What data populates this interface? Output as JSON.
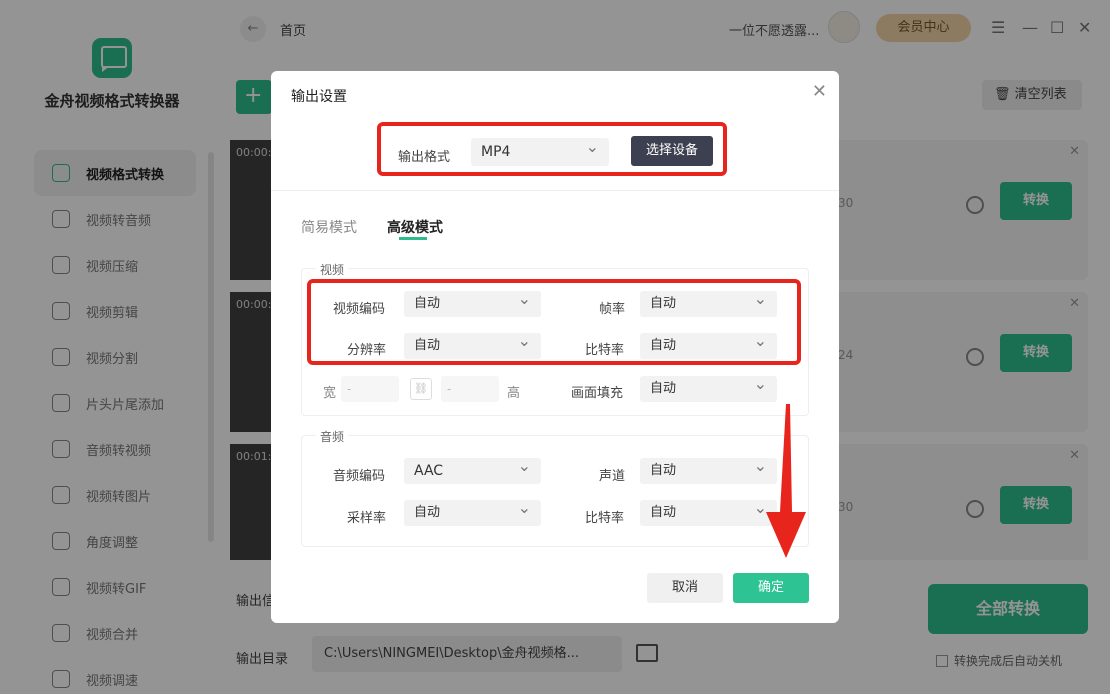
{
  "app": {
    "name": "金舟视频格式转换器"
  },
  "sidebar": {
    "items": [
      {
        "label": "视频格式转换",
        "icon": "convert-icon",
        "active": true
      },
      {
        "label": "视频转音频",
        "icon": "music-icon"
      },
      {
        "label": "视频压缩",
        "icon": "compress-icon"
      },
      {
        "label": "视频剪辑",
        "icon": "scissors-icon"
      },
      {
        "label": "视频分割",
        "icon": "split-icon"
      },
      {
        "label": "片头片尾添加",
        "icon": "film-icon"
      },
      {
        "label": "音频转视频",
        "icon": "disc-icon"
      },
      {
        "label": "视频转图片",
        "icon": "image-icon"
      },
      {
        "label": "角度调整",
        "icon": "rotate-icon"
      },
      {
        "label": "视频转GIF",
        "icon": "gif-icon"
      },
      {
        "label": "视频合并",
        "icon": "merge-icon"
      },
      {
        "label": "视频调速",
        "icon": "speed-icon"
      }
    ]
  },
  "topbar": {
    "back": "←",
    "home": "首页",
    "user": "一位不愿透露...",
    "vip": "会员中心",
    "min": "☰",
    "max": "—",
    "restore": "☐",
    "close": "✕"
  },
  "toolbar": {
    "add": "+ ",
    "clear": "清空列表"
  },
  "files": [
    {
      "time": "00:00:",
      "info": "30",
      "convert": "转换"
    },
    {
      "time": "00:00:",
      "info": "24",
      "convert": "转换"
    },
    {
      "time": "00:01:",
      "info": "30",
      "convert": "转换"
    }
  ],
  "bottom": {
    "out_info": "输出信",
    "out_dir_label": "输出目录",
    "out_dir": "C:\\Users\\NINGMEI\\Desktop\\金舟视频格...",
    "convert_all": "全部转换",
    "auto_shutdown": "转换完成后自动关机"
  },
  "modal": {
    "title": "输出设置",
    "close": "✕",
    "format_label": "输出格式",
    "format_value": "MP4",
    "select_device": "选择设备",
    "tabs": [
      {
        "label": "简易模式"
      },
      {
        "label": "高级模式",
        "active": true
      }
    ],
    "video": {
      "title": "视频",
      "codec_label": "视频编码",
      "codec": "自动",
      "fps_label": "帧率",
      "fps": "自动",
      "res_label": "分辨率",
      "res": "自动",
      "bitrate_label": "比特率",
      "bitrate": "自动",
      "width_label": "宽",
      "width": "-",
      "height_label": "高",
      "height": "-",
      "fill_label": "画面填充",
      "fill": "自动"
    },
    "audio": {
      "title": "音频",
      "codec_label": "音频编码",
      "codec": "AAC",
      "channel_label": "声道",
      "channel": "自动",
      "rate_label": "采样率",
      "rate": "自动",
      "bitrate_label": "比特率",
      "bitrate": "自动"
    },
    "cancel": "取消",
    "ok": "确定"
  },
  "colors": {
    "accent": "#2dbd8c",
    "annotation": "#e8251d"
  }
}
